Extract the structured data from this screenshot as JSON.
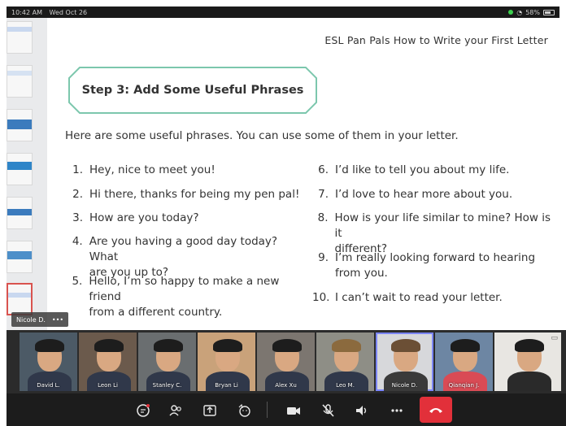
{
  "status_bar": {
    "time": "10:42 AM",
    "date": "Wed Oct 26",
    "battery": "58%"
  },
  "document": {
    "header_title": "ESL Pan Pals How to Write your First Letter",
    "step_title": "Step 3: Add Some Useful Phrases",
    "intro": "Here are some useful phrases. You can use some of them in your letter.",
    "phrases_left": [
      {
        "num": "1.",
        "lines": [
          "Hey, nice to meet you!"
        ]
      },
      {
        "num": "2.",
        "lines": [
          "Hi there, thanks for being my pen pal!"
        ]
      },
      {
        "num": "3.",
        "lines": [
          "How are you today?"
        ]
      },
      {
        "num": "4.",
        "lines": [
          "Are you having a good day today? What",
          "are you up to?"
        ]
      },
      {
        "num": "5.",
        "lines": [
          "Hello, I’m so happy to make a new friend",
          "from a different country."
        ]
      }
    ],
    "phrases_right": [
      {
        "num": "6.",
        "lines": [
          "I’d like to tell you about my life."
        ]
      },
      {
        "num": "7.",
        "lines": [
          "I’d love to hear more about you."
        ]
      },
      {
        "num": "8.",
        "lines": [
          "How is your life similar to mine? How is it",
          "different?"
        ]
      },
      {
        "num": "9.",
        "lines": [
          "I’m really looking forward to hearing",
          "from you."
        ]
      },
      {
        "num": "10.",
        "lines": [
          "I can’t wait to read your letter."
        ]
      }
    ]
  },
  "presenter_tag": {
    "name": "Nicole D.",
    "more": "•••"
  },
  "participants": [
    {
      "name": "David L."
    },
    {
      "name": "Leon Li"
    },
    {
      "name": "Stanley C."
    },
    {
      "name": "Bryan Li"
    },
    {
      "name": "Alex Xu"
    },
    {
      "name": "Leo M."
    },
    {
      "name": "Nicole D."
    },
    {
      "name": "Qianqian J."
    },
    {
      "name": ""
    }
  ],
  "colors": {
    "step_box_border": "#7cc7ad",
    "hangup": "#e2303a",
    "active_tile_outline": "#7b86ff",
    "slide_thumb_bands": [
      "#c9d8ef",
      "#d6e2f2",
      "#3b7bbd",
      "#2f85c8",
      "#3b7bbd",
      "#4d8fc9",
      "#c9d8ef"
    ]
  },
  "controls": [
    "chat-icon",
    "participants-icon",
    "share-screen-icon",
    "reactions-icon",
    "camera-icon",
    "mute-icon",
    "speaker-icon",
    "more-icon",
    "hang-up-icon"
  ]
}
